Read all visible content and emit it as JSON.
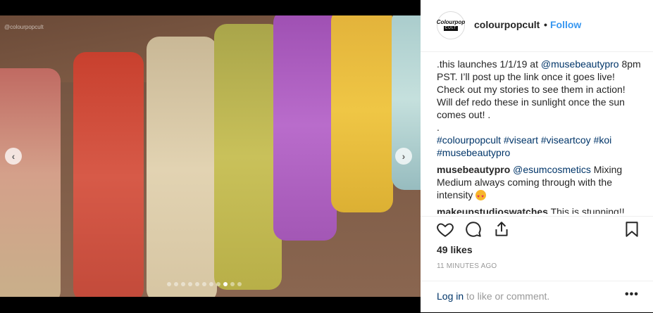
{
  "post": {
    "watermark": "@colourpopcult",
    "carousel": {
      "total": 11,
      "active": 9
    }
  },
  "header": {
    "avatar_text_1": "Colourpop",
    "avatar_text_2": "CULT",
    "username": "colourpopcult",
    "separator": "•",
    "follow_label": "Follow"
  },
  "caption": {
    "intro": ".this launches 1/1/19 at ",
    "mention": "@musebeautypro",
    "text": " 8pm PST. I’ll post up the link once it goes live! Check out my stories to see them in action! Will def redo these in sunlight once the sun comes out! .",
    "dot": ".",
    "hashtags": [
      "#colourpopcult",
      "#viseart",
      "#viseartcoy",
      "#koi",
      "#musebeautypro"
    ]
  },
  "comments": [
    {
      "user": "musebeautypro",
      "mention": "@esumcosmetics",
      "text": " Mixing Medium always coming through with the intensity"
    },
    {
      "user": "makeupstudioswatches",
      "text": " This is stunning!!"
    }
  ],
  "actions": {
    "like": "heart-icon",
    "comment": "comment-icon",
    "share": "share-icon",
    "save": "bookmark-icon"
  },
  "likes": "49 likes",
  "time": "11 MINUTES AGO",
  "footer": {
    "login_link": "Log in",
    "login_text": " to like or comment.",
    "more": "•••"
  },
  "swatch_colors": [
    "#c8766a",
    "#d24a3a",
    "#d8c7a5",
    "#bdb450",
    "#a85ab8",
    "#e0b636",
    "#9fc6c6"
  ]
}
